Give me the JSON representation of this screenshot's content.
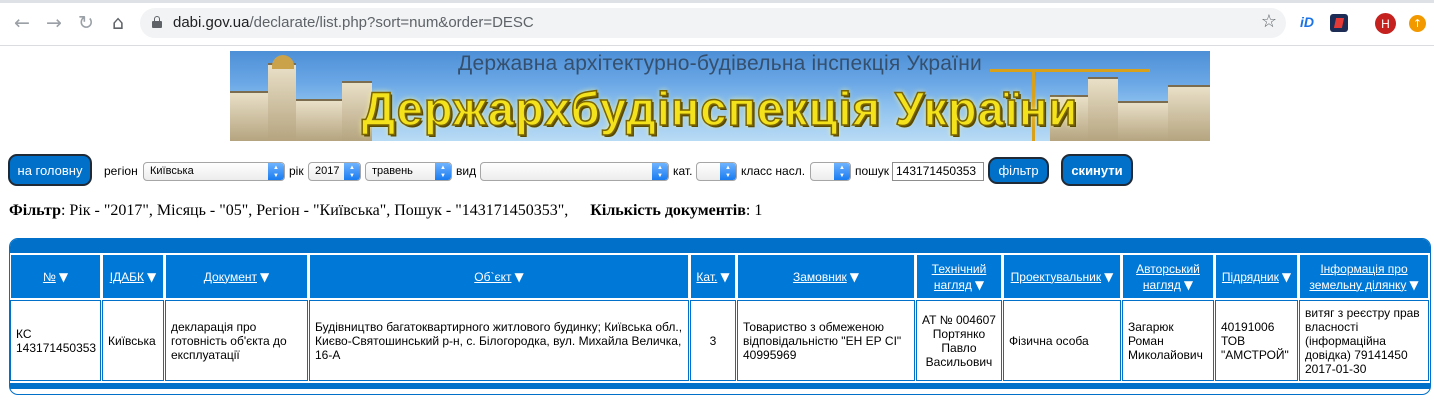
{
  "browser": {
    "url_host": "dabi.gov.ua",
    "url_path": "/declarate/list.php?sort=num&order=DESC",
    "avatar_letter": "Н",
    "icons": [
      "back-icon",
      "forward-icon",
      "reload-icon",
      "home-icon",
      "lock-icon",
      "star-icon",
      "extension-icon",
      "update-icon"
    ]
  },
  "banner": {
    "subtitle": "Державна архітектурно-будівельна інспекція України",
    "title": "Держархбудінспекція України"
  },
  "filters": {
    "home_button": "на головну",
    "region_label": "регіон",
    "region_value": "Київська",
    "year_label": "рік",
    "year_value": "2017",
    "month_value": "травень",
    "type_label": "вид",
    "type_value": "",
    "cat_label": "кат.",
    "cat_value": "",
    "class_label": "класс насл.",
    "class_value": "",
    "search_label": "пошук",
    "search_value": "143171450353",
    "filter_button": "фільтр",
    "reset_button": "скинути"
  },
  "summary": {
    "filter_label": "Фільтр",
    "filter_text": ": Рік - \"2017\", Місяць - \"05\", Регіон - \"Київська\", Пошук - \"143171450353\",",
    "count_label": "Кількість документів",
    "count_value": ": 1"
  },
  "table": {
    "sort_glyph": "▼",
    "headers": [
      {
        "line1": "№",
        "line2": ""
      },
      {
        "line1": "ІДАБК",
        "line2": ""
      },
      {
        "line1": "Документ",
        "line2": ""
      },
      {
        "line1": "Об`єкт",
        "line2": ""
      },
      {
        "line1": "Кат.",
        "line2": ""
      },
      {
        "line1": "Замовник",
        "line2": ""
      },
      {
        "line1": "Технічний",
        "line2": "нагляд"
      },
      {
        "line1": "Проектувальник",
        "line2": ""
      },
      {
        "line1": "Авторський",
        "line2": "нагляд"
      },
      {
        "line1": "Підрядник",
        "line2": ""
      },
      {
        "line1": "Інформація про",
        "line2": "земельну ділянку"
      }
    ],
    "row": [
      "КС 143171450353",
      "Київська",
      "декларація про готовність об'єкта до експлуатації",
      "Будівництво багатоквартирного житлового будинку; Київська обл., Києво-Святошинський р-н, с. Білогородка, вул. Михайла Величка, 16-А",
      "3",
      "Товариство з обмеженою відповідальністю \"ЕН ЕР СІ\" 40995969",
      "АТ № 004607 Портянко Павло Васильович",
      "Фізична особа",
      "Загарюк Роман Миколайович",
      "40191006 ТОВ \"АМСТРОЙ\"",
      "витяг з реєстру прав власності (інформаційна довідка) 79141450 2017-01-30"
    ]
  },
  "colors": {
    "accent": "#0070c9",
    "header_bg": "#0078d7",
    "banner_title": "#f3e21c"
  }
}
